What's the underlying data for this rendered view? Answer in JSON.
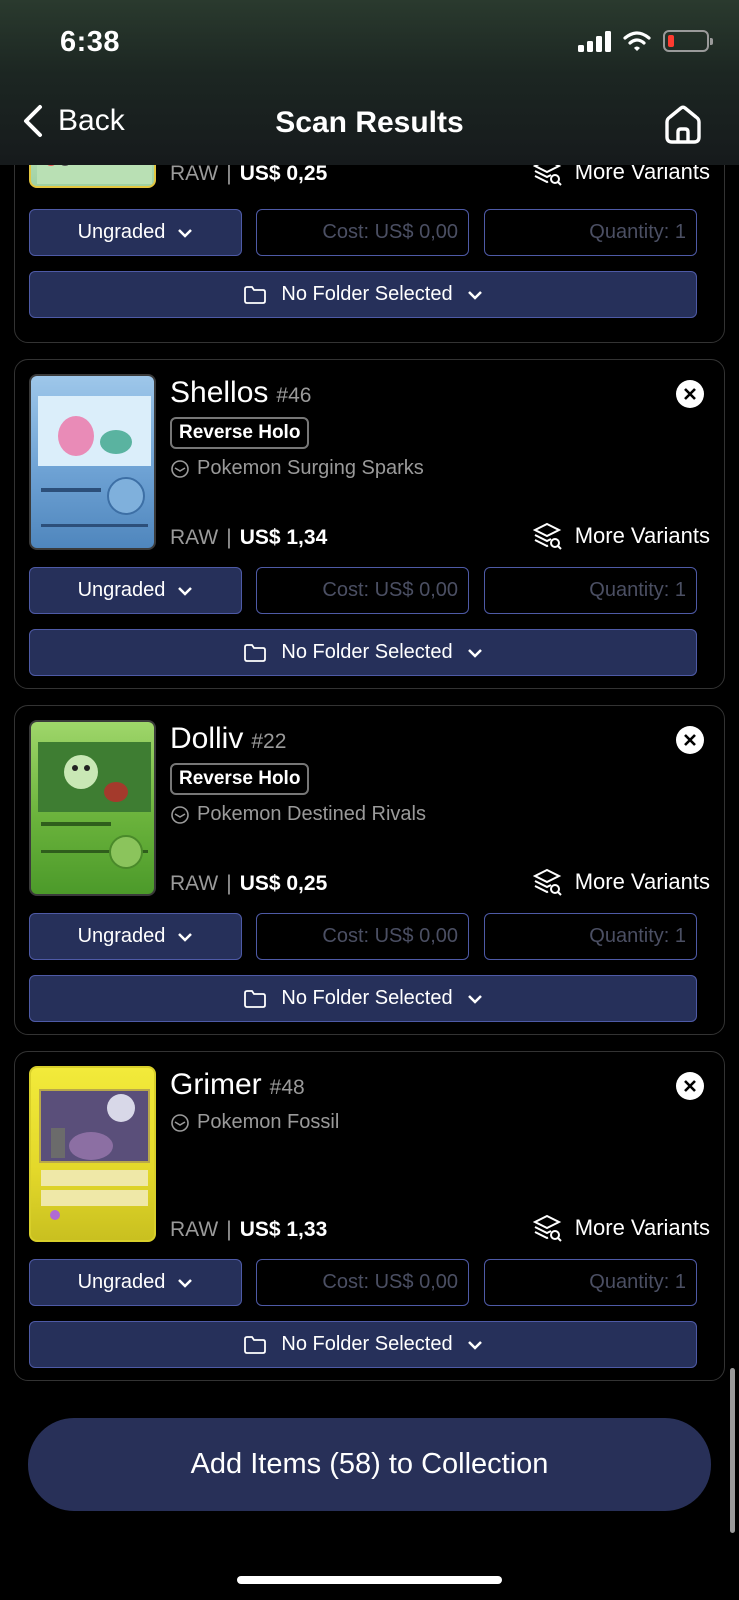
{
  "status": {
    "time": "6:38"
  },
  "nav": {
    "back_label": "Back",
    "title": "Scan Results"
  },
  "labels": {
    "more_variants": "More Variants",
    "grade": "Ungraded",
    "cost_placeholder": "Cost: US$ 0,00",
    "quantity_placeholder": "Quantity: 1",
    "folder": "No Folder Selected",
    "raw": "RAW",
    "sep": "|"
  },
  "cards": [
    {
      "name": "",
      "number": "",
      "variant": "",
      "set": "",
      "price": "US$ 0,25"
    },
    {
      "name": "Shellos",
      "number": "#46",
      "variant": "Reverse Holo",
      "set": "Pokemon Surging Sparks",
      "price": "US$ 1,34"
    },
    {
      "name": "Dolliv",
      "number": "#22",
      "variant": "Reverse Holo",
      "set": "Pokemon Destined Rivals",
      "price": "US$ 0,25"
    },
    {
      "name": "Grimer",
      "number": "#48",
      "variant": "",
      "set": "Pokemon Fossil",
      "price": "US$ 1,33"
    }
  ],
  "add_button": "Add Items (58) to Collection",
  "colors": {
    "accent": "#26305a",
    "accent_border": "#4e5aa6",
    "battery_low": "#ff3b30"
  }
}
